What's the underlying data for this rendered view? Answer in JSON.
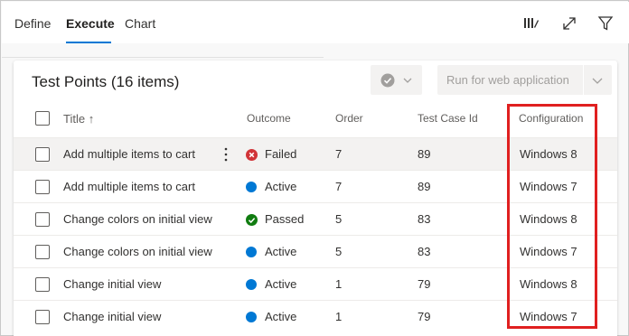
{
  "tabs": [
    {
      "label": "Define",
      "active": false
    },
    {
      "label": "Execute",
      "active": true
    },
    {
      "label": "Chart",
      "active": false
    }
  ],
  "toolbar_icons": [
    "column-options-icon",
    "expand-icon",
    "filter-icon"
  ],
  "card": {
    "title": "Test Points (16 items)",
    "outcome_button_icon": "check-circle-icon",
    "run_button_label": "Run for web application"
  },
  "columns": {
    "title": "Title",
    "title_sort": "↑",
    "outcome": "Outcome",
    "order": "Order",
    "test_case_id": "Test Case Id",
    "configuration": "Configuration"
  },
  "rows": [
    {
      "title": "Add multiple items to cart",
      "outcome": "Failed",
      "order": "7",
      "test_case_id": "89",
      "configuration": "Windows 8"
    },
    {
      "title": "Add multiple items to cart",
      "outcome": "Active",
      "order": "7",
      "test_case_id": "89",
      "configuration": "Windows 7"
    },
    {
      "title": "Change colors on initial view",
      "outcome": "Passed",
      "order": "5",
      "test_case_id": "83",
      "configuration": "Windows 8"
    },
    {
      "title": "Change colors on initial view",
      "outcome": "Active",
      "order": "5",
      "test_case_id": "83",
      "configuration": "Windows 7"
    },
    {
      "title": "Change initial view",
      "outcome": "Active",
      "order": "1",
      "test_case_id": "79",
      "configuration": "Windows 8"
    },
    {
      "title": "Change initial view",
      "outcome": "Active",
      "order": "1",
      "test_case_id": "79",
      "configuration": "Windows 7"
    }
  ],
  "colors": {
    "accent": "#0078d4",
    "failed": "#d13438",
    "active": "#0078d4",
    "passed": "#107c10",
    "highlight": "#e02020"
  }
}
